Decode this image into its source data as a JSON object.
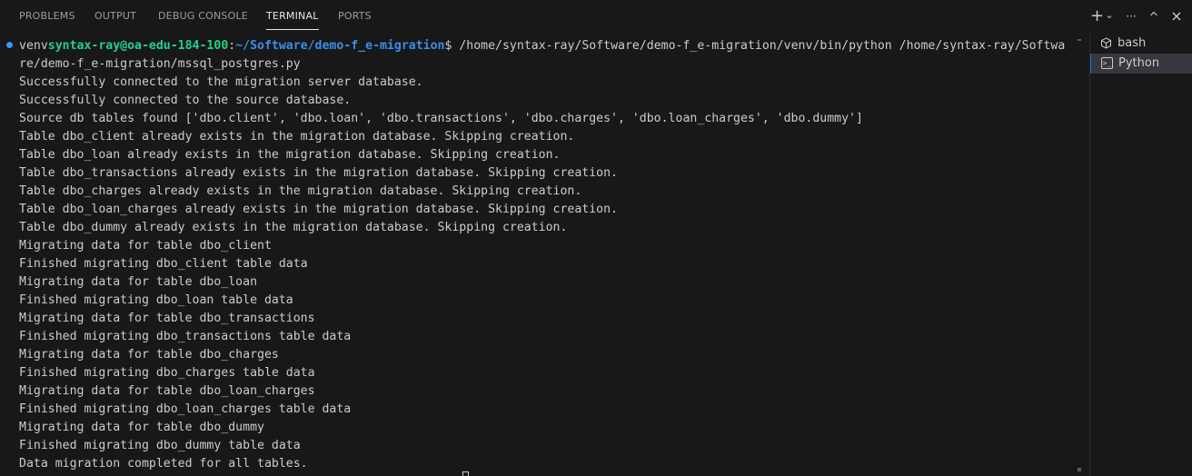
{
  "tabs": [
    {
      "label": "PROBLEMS",
      "active": false
    },
    {
      "label": "OUTPUT",
      "active": false
    },
    {
      "label": "DEBUG CONSOLE",
      "active": false
    },
    {
      "label": "TERMINAL",
      "active": true
    },
    {
      "label": "PORTS",
      "active": false
    }
  ],
  "header_icons": {
    "add": "+",
    "dropdown": "⌄",
    "more": "···",
    "maximize": "^",
    "close": "×"
  },
  "prompt": {
    "venv": "venv",
    "user_host": "syntax-ray@oa-edu-184-100",
    "colon": ":",
    "path": "~/Software/demo-f_e-migration",
    "symbol": "$ ",
    "command": "/home/syntax-ray/Software/demo-f_e-migration/venv/bin/python /home/syntax-ray/Softwa"
  },
  "output_lines": [
    "re/demo-f_e-migration/mssql_postgres.py",
    "Successfully connected to the migration server database.",
    "Successfully connected to the source database.",
    "Source db tables found ['dbo.client', 'dbo.loan', 'dbo.transactions', 'dbo.charges', 'dbo.loan_charges', 'dbo.dummy']",
    "Table dbo_client already exists in the migration database. Skipping creation.",
    "Table dbo_loan already exists in the migration database. Skipping creation.",
    "Table dbo_transactions already exists in the migration database. Skipping creation.",
    "Table dbo_charges already exists in the migration database. Skipping creation.",
    "Table dbo_loan_charges already exists in the migration database. Skipping creation.",
    "Table dbo_dummy already exists in the migration database. Skipping creation.",
    "Migrating data for table dbo_client",
    "Finished migrating dbo_client table data",
    "Migrating data for table dbo_loan",
    "Finished migrating dbo_loan table data",
    "Migrating data for table dbo_transactions",
    "Finished migrating dbo_transactions table data",
    "Migrating data for table dbo_charges",
    "Finished migrating dbo_charges table data",
    "Migrating data for table dbo_loan_charges",
    "Finished migrating dbo_loan_charges table data",
    "Migrating data for table dbo_dummy",
    "Finished migrating dbo_dummy table data",
    "Data migration completed for all tables."
  ],
  "terminals": [
    {
      "label": "bash",
      "icon": "terminal-bash-icon",
      "selected": false
    },
    {
      "label": "Python",
      "icon": "terminal-python-icon",
      "selected": true
    }
  ],
  "colors": {
    "background": "#181818",
    "prompt_green": "#23d18b",
    "prompt_blue": "#3b8eea",
    "accent": "#0078d4"
  }
}
